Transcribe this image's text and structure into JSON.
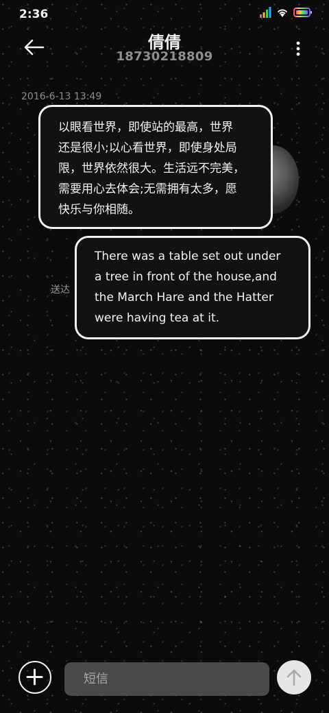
{
  "status_bar": {
    "time": "2:36"
  },
  "header": {
    "title": "倩倩",
    "subtitle": "18730218809"
  },
  "conversation": {
    "timestamp": "2016-6-13 13:49",
    "messages": [
      {
        "direction": "incoming",
        "lines": [
          "以眼看世界，即使站的最高，世界",
          "还是很小;以心看世界，即使身处局",
          "限，世界依然很大。生活远不完美，",
          "需要用心去体会;无需拥有太多，愿",
          "快乐与你相随。"
        ]
      },
      {
        "direction": "outgoing",
        "lines": [
          "There was a table set out under",
          "a tree in front of the house,and",
          "the March Hare and the Hatter",
          "were having tea at it."
        ],
        "status": "送达"
      }
    ]
  },
  "compose": {
    "placeholder": "短信"
  },
  "icons": {
    "back": "arrow-left-icon",
    "more": "more-vertical-icon",
    "add": "plus-circle-icon",
    "send": "arrow-up-icon"
  },
  "colors": {
    "background": "#0b0b0c",
    "bubble_border": "#f2f2f2",
    "input_bg": "#4a4a4a",
    "send_bg": "#e6e6e6"
  }
}
